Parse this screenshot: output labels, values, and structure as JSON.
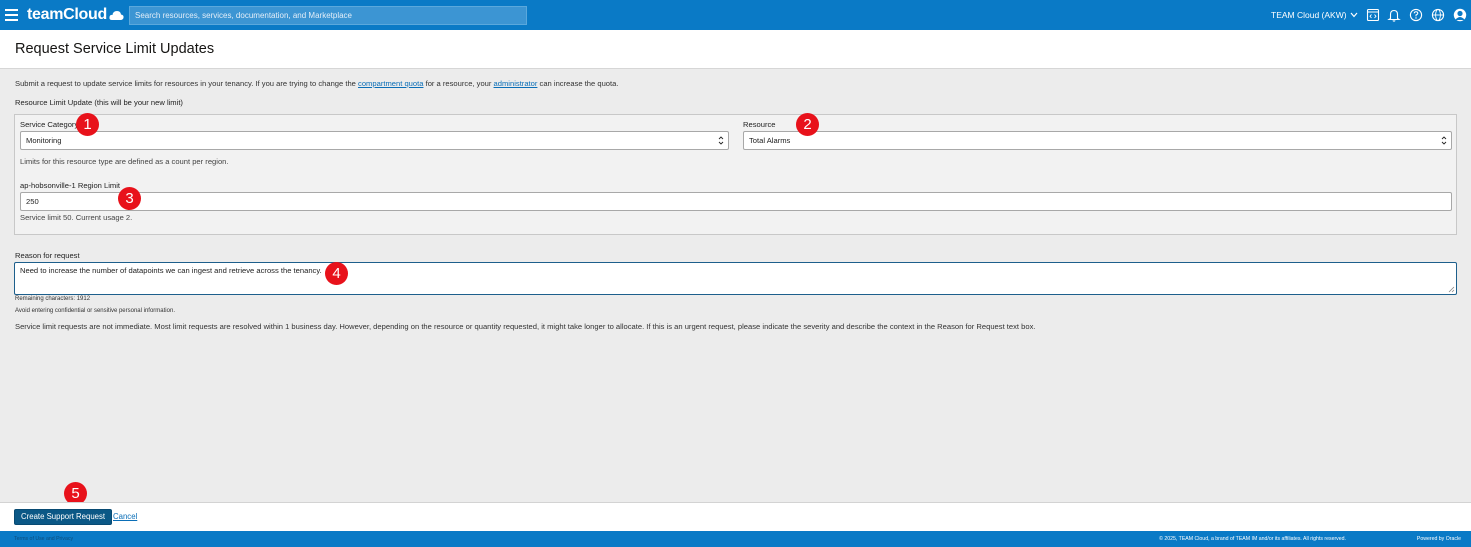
{
  "topbar": {
    "brand": "teamCloud",
    "search_placeholder": "Search resources, services, documentation, and Marketplace",
    "tenancy_label": "TEAM Cloud (AKW)"
  },
  "page": {
    "title": "Request Service Limit Updates",
    "intro_prefix": "Submit a request to update service limits for resources in your tenancy. If you are trying to change the ",
    "intro_link_quota": "compartment quota",
    "intro_middle": " for a resource, your ",
    "intro_link_admin": "administrator",
    "intro_suffix": " can increase the quota.",
    "section_label": "Resource Limit Update (this will be your new limit)"
  },
  "form": {
    "service_category_label": "Service Category",
    "service_category_value": "Monitoring",
    "resource_label": "Resource",
    "resource_value": "Total Alarms",
    "limits_hint": "Limits for this resource type are defined as a count per region.",
    "region_limit_label": "ap-hobsonville-1 Region Limit",
    "region_limit_value": "250",
    "usage_hint": "Service limit 50. Current usage 2.",
    "reason_label": "Reason for request",
    "reason_value": "Need to increase the number of datapoints we can ingest and retrieve across the tenancy.",
    "remaining_chars": "Remaining characters: 1912",
    "privacy_note": "Avoid entering confidential or sensitive personal information.",
    "info_text": "Service limit requests are not immediate. Most limit requests are resolved within 1 business day. However, depending on the resource or quantity requested, it might take longer to allocate. If this is an urgent request, please indicate the severity and describe the context in the Reason for Request text box."
  },
  "badges": [
    "1",
    "2",
    "3",
    "4",
    "5"
  ],
  "actions": {
    "create_label": "Create Support Request",
    "cancel_label": "Cancel"
  },
  "footer": {
    "terms": "Terms of Use and Privacy",
    "copyright": "© 2025, TEAM Cloud, a brand of TEAM IM and/or its affiliates. All rights reserved.",
    "powered": "Powered by Oracle"
  },
  "colors": {
    "topbar": "#0a7ac6",
    "primary_button": "#0b5886",
    "badge": "#e8121b",
    "link": "#0a6eb7"
  },
  "icons": [
    "menu-icon",
    "cloud-logo-icon",
    "chevron-down-icon",
    "code-editor-icon",
    "bell-icon",
    "help-icon",
    "globe-icon",
    "profile-icon",
    "select-arrows-icon",
    "resize-handle-icon"
  ]
}
